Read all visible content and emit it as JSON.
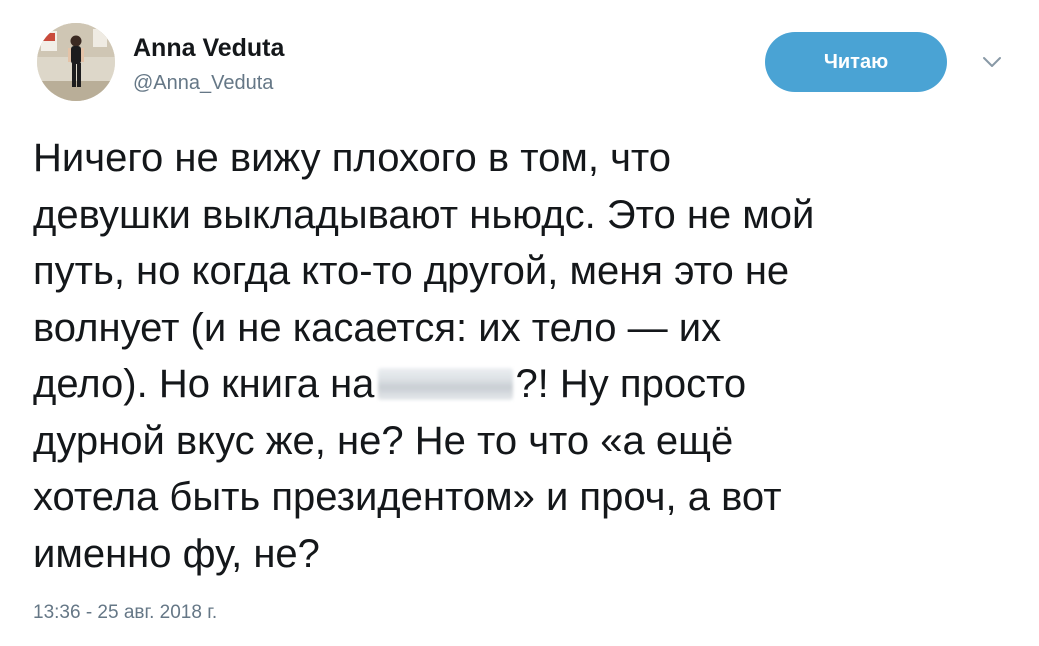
{
  "tweet": {
    "author_name": "Anna Veduta",
    "author_handle": "@Anna_Veduta",
    "follow_button_label": "Читаю",
    "text_lines": [
      "Ничего не вижу плохого в том, что",
      "девушки выкладывают ньюдс. Это не мой",
      "путь, но когда кто-то другой, меня это не",
      "волнует (и не касается: их тело — их",
      "дело). Но книга на",
      "?! Ну просто",
      "дурной вкус же, не? Не то что «а ещё",
      "хотела быть президентом» и проч, а вот",
      "именно фу, не?"
    ],
    "timestamp": "13:36 - 25 авг. 2018 г."
  },
  "icons": {
    "avatar": "profile-photo",
    "menu": "chevron-down-icon"
  },
  "colors": {
    "follow_button_bg": "#4aa3d4",
    "follow_button_text": "#ffffff",
    "text_primary": "#14171a",
    "text_secondary": "#657786"
  }
}
